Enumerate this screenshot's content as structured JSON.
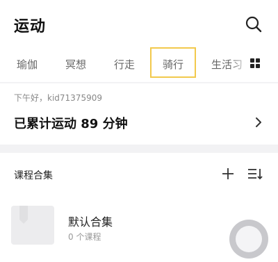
{
  "header": {
    "title": "运动"
  },
  "tabs": [
    {
      "label": "瑜伽"
    },
    {
      "label": "冥想"
    },
    {
      "label": "行走"
    },
    {
      "label": "骑行"
    },
    {
      "label": "生活习"
    }
  ],
  "active_tab_index": 3,
  "summary": {
    "greeting": "下午好，kid71375909",
    "total": "已累计运动 89 分钟"
  },
  "collections": {
    "title": "课程合集",
    "items": [
      {
        "name": "默认合集",
        "count": "0 个课程"
      }
    ]
  },
  "colors": {
    "accent_border": "#f2c94c",
    "background": "#f2f2f4"
  },
  "icons": [
    "search-icon",
    "grid-icon",
    "chevron-right-icon",
    "plus-icon",
    "sort-icon",
    "bookmark-icon",
    "floating-ball-icon"
  ]
}
